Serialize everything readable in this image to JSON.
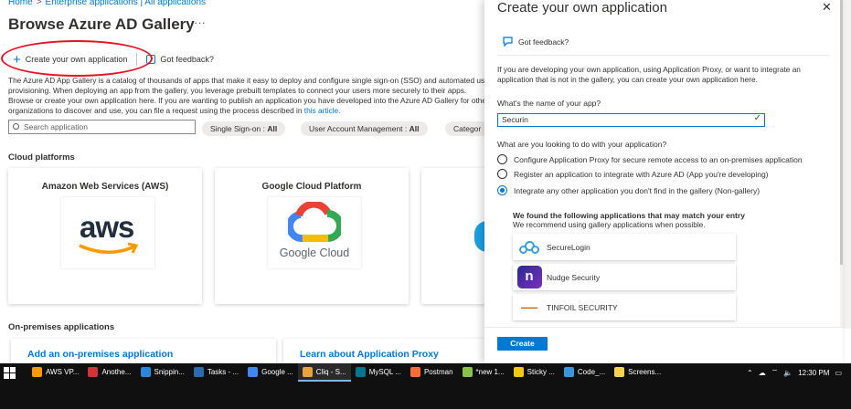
{
  "breadcrumb": {
    "items": [
      "Home",
      "Enterprise applications | All applications"
    ],
    "separator": ">"
  },
  "page": {
    "title": "Browse Azure AD Gallery",
    "more": "···"
  },
  "toolbar": {
    "create_label": "Create your own application",
    "feedback_label": "Got feedback?"
  },
  "description": {
    "text": "The Azure AD App Gallery is a catalog of thousands of apps that make it easy to deploy and configure single sign-on (SSO) and automated user provisioning. When deploying an app from the gallery, you leverage prebuilt templates to connect your users more securely to their apps. Browse or create your own application here. If you are wanting to publish an application you have developed into the Azure AD Gallery for other organizations to discover and use, you can file a request using the process described in ",
    "link": "this article."
  },
  "search": {
    "placeholder": "Search application"
  },
  "filters": [
    {
      "label": "Single Sign-on :",
      "value": "All"
    },
    {
      "label": "User Account Management :",
      "value": "All"
    },
    {
      "label": "Categor",
      "value": ""
    }
  ],
  "cloud_section": {
    "title": "Cloud platforms",
    "cards": [
      {
        "title": "Amazon Web Services (AWS)",
        "logo_text": "aws"
      },
      {
        "title": "Google Cloud Platform",
        "logo_text": "Google Cloud"
      }
    ]
  },
  "onprem_section": {
    "title": "On-premises applications",
    "cards": [
      {
        "title": "Add an on-premises application"
      },
      {
        "title": "Learn about Application Proxy"
      }
    ]
  },
  "panel": {
    "title": "Create your own application",
    "close": "✕",
    "feedback": "Got feedback?",
    "intro": "If you are developing your own application, using Application Proxy, or want to integrate an application that is not in the gallery, you can create your own application here.",
    "name_label": "What's the name of your app?",
    "name_value": "Securin",
    "purpose_label": "What are you looking to do with your application?",
    "options": [
      {
        "label": "Configure Application Proxy for secure remote access to an on-premises application",
        "selected": false
      },
      {
        "label": "Register an application to integrate with Azure AD (App you're developing)",
        "selected": false
      },
      {
        "label": "Integrate any other application you don't find in the gallery (Non-gallery)",
        "selected": true
      }
    ],
    "matches_title": "We found the following applications that may match your entry",
    "matches_sub": "We recommend using gallery applications when possible.",
    "matches": [
      {
        "name": "SecureLogin",
        "icon": "securelogin-icon"
      },
      {
        "name": "Nudge Security",
        "icon": "nudge-icon"
      },
      {
        "name": "TINFOIL SECURITY",
        "icon": "tinfoil-icon"
      }
    ],
    "create_label": "Create",
    "accent": "#0078d4"
  },
  "taskbar": {
    "tasks": [
      {
        "label": "AWS VP...",
        "color": "#ff9900"
      },
      {
        "label": "Anothe...",
        "color": "#d13438"
      },
      {
        "label": "Snippin...",
        "color": "#2b88d8"
      },
      {
        "label": "Tasks - ...",
        "color": "#2b6cb0"
      },
      {
        "label": "Google ...",
        "color": "#4285f4"
      },
      {
        "label": "Cliq - S...",
        "color": "#e8a33d"
      },
      {
        "label": "MySQL ...",
        "color": "#00758f"
      },
      {
        "label": "Postman",
        "color": "#ff6c37"
      },
      {
        "label": "*new 1...",
        "color": "#8bc34a"
      },
      {
        "label": "Sticky ...",
        "color": "#f2c811"
      },
      {
        "label": "Code_...",
        "color": "#3a96dd"
      },
      {
        "label": "Screens...",
        "color": "#f7d24b"
      }
    ],
    "time": "12:30 PM"
  }
}
